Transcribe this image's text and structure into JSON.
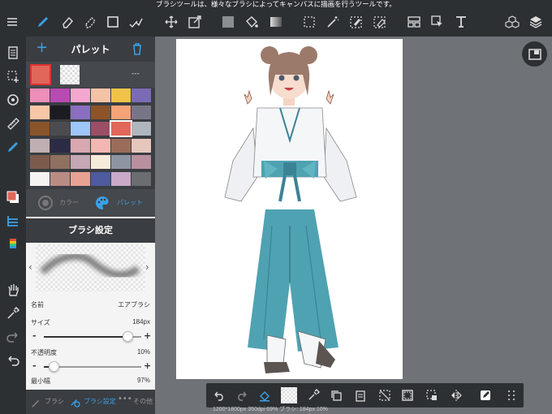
{
  "tooltip": "ブラシツールは、様々なブラシによってキャンバスに描画を行うツールです。",
  "palette": {
    "title": "パレット",
    "opacity_text": "---",
    "current_color": "#e0675a",
    "tab_color": "カラー",
    "tab_palette": "パレット",
    "swatches": [
      [
        "#ee8fb8",
        "#b64bb2",
        "#f3a7cf",
        "#f4c3a5",
        "#f0c348",
        "#7b6bb5"
      ],
      [
        "#f6c6a6",
        "#1b1b22",
        "#8b6ec0",
        "#8f5328",
        "#f6a377",
        "#767688"
      ],
      [
        "#8a542b",
        "#4c4c50",
        "#9ec7f7",
        "#9a4f66",
        "#e0675a",
        "#b0b6be"
      ],
      [
        "#c0afb2",
        "#2c2b45",
        "#d9a7b0",
        "#f2b7b0",
        "#9a6d5a",
        "#e7c6bd"
      ],
      [
        "#7d5b4c",
        "#90705f",
        "#c4a8b4",
        "#f6ebda",
        "#8e95a2",
        "#b8909e"
      ],
      [
        "#f5f3f2",
        "#b88c83",
        "#e7a292",
        "#4e5b9e",
        "#c9a9c8",
        "#6c6d70"
      ]
    ]
  },
  "brush": {
    "title": "ブラシ設定",
    "name_label": "名前",
    "name_value": "エアブラシ",
    "size_label": "サイズ",
    "size_value": "184px",
    "size_level": 0.86,
    "opacity_label": "不透明度",
    "opacity_value": "10%",
    "opacity_level": 0.1,
    "min_width_label": "最小幅",
    "min_width_value": "97%",
    "footer_brush": "ブラシ",
    "footer_settings": "ブラシ設定",
    "footer_other": "その他"
  },
  "status": "1200*1800px 350dpi 69% ブラシ: 184px 10%",
  "colors": {
    "accent": "#3aa0e8",
    "toolbar_bg": "#2d3033",
    "canvas_bg": "#6f7378"
  }
}
